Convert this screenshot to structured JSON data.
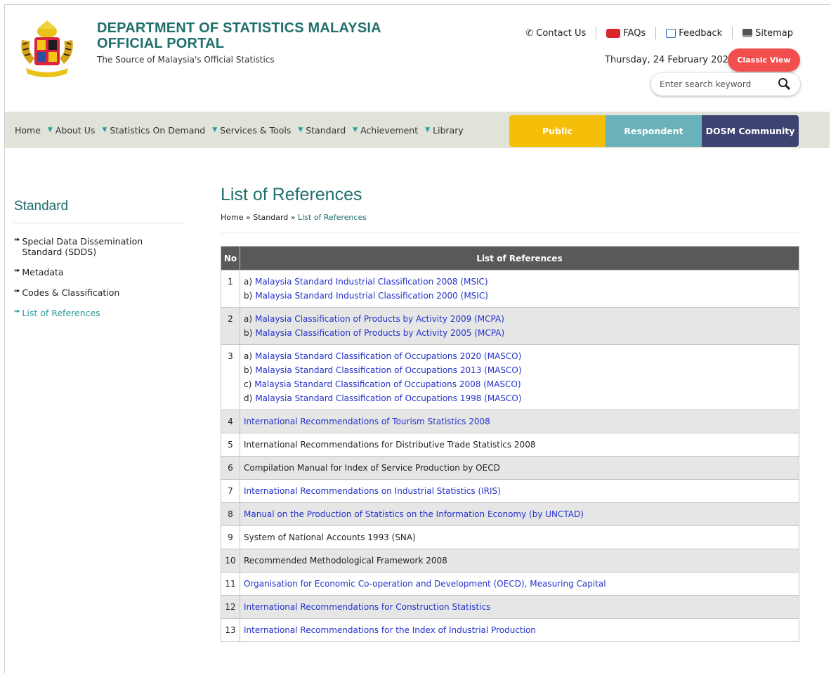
{
  "header": {
    "title_line1": "DEPARTMENT OF STATISTICS MALAYSIA",
    "title_line2": "OFFICIAL PORTAL",
    "subtitle": "The Source of Malaysia's Official Statistics",
    "links": [
      "Contact Us",
      "FAQs",
      "Feedback",
      "Sitemap"
    ],
    "date": "Thursday, 24 February 2022",
    "classic_view": "Classic View",
    "search_placeholder": "Enter search keyword"
  },
  "nav": {
    "home": "Home",
    "items": [
      "About Us",
      "Statistics On Demand",
      "Services & Tools",
      "Standard",
      "Achievement",
      "Library"
    ],
    "audiences": [
      "Public",
      "Respondent",
      "DOSM Community"
    ]
  },
  "sidebar": {
    "title": "Standard",
    "items": [
      "Special Data Dissemination Standard (SDDS)",
      "Metadata",
      "Codes & Classification",
      "List of References"
    ]
  },
  "main": {
    "title": "List of References",
    "breadcrumb": {
      "home": "Home",
      "sep": "»",
      "section": "Standard",
      "current": "List of References"
    },
    "table": {
      "headers": [
        "No",
        "List of References"
      ],
      "rows": [
        {
          "no": "1",
          "items": [
            {
              "label": "a)",
              "text": "Malaysia Standard Industrial Classification 2008 (MSIC)",
              "link": true
            },
            {
              "label": "b)",
              "text": "Malaysia Standard Industrial Classification 2000 (MSIC)",
              "link": true
            }
          ]
        },
        {
          "no": "2",
          "items": [
            {
              "label": "a)",
              "text": "Malaysia Classification of Products by Activity 2009 (MCPA)",
              "link": true
            },
            {
              "label": "b)",
              "text": "Malaysia Classification of Products by Activity 2005 (MCPA)",
              "link": true
            }
          ]
        },
        {
          "no": "3",
          "items": [
            {
              "label": "a)",
              "text": "Malaysia Standard Classification of Occupations 2020 (MASCO)",
              "link": true
            },
            {
              "label": "b)",
              "text": "Malaysia Standard Classification of Occupations 2013 (MASCO)",
              "link": true
            },
            {
              "label": "c)",
              "text": "Malaysia Standard Classification of Occupations 2008 (MASCO)",
              "link": true
            },
            {
              "label": "d)",
              "text": "Malaysia Standard Classification of Occupations 1998 (MASCO)",
              "link": true
            }
          ]
        },
        {
          "no": "4",
          "items": [
            {
              "label": "",
              "text": "International Recommendations of Tourism Statistics 2008",
              "link": true
            }
          ]
        },
        {
          "no": "5",
          "items": [
            {
              "label": "",
              "text": "International Recommendations for Distributive Trade Statistics 2008",
              "link": false
            }
          ]
        },
        {
          "no": "6",
          "items": [
            {
              "label": "",
              "text": "Compilation Manual for Index of Service Production by OECD",
              "link": false
            }
          ]
        },
        {
          "no": "7",
          "items": [
            {
              "label": "",
              "text": "International Recommendations on Industrial Statistics (IRIS)",
              "link": true
            }
          ]
        },
        {
          "no": "8",
          "items": [
            {
              "label": "",
              "text": "Manual on the Production of Statistics on the Information Economy (by UNCTAD)",
              "link": true
            }
          ]
        },
        {
          "no": "9",
          "items": [
            {
              "label": "",
              "text": "System of National Accounts 1993 (SNA)",
              "link": false
            }
          ]
        },
        {
          "no": "10",
          "items": [
            {
              "label": "",
              "text": "Recommended Methodological Framework 2008",
              "link": false
            }
          ]
        },
        {
          "no": "11",
          "items": [
            {
              "label": "",
              "text": "Organisation for Economic Co-operation and Development (OECD), Measuring Capital",
              "link": true
            }
          ]
        },
        {
          "no": "12",
          "items": [
            {
              "label": "",
              "text": "International Recommendations for Construction Statistics",
              "link": true
            }
          ]
        },
        {
          "no": "13",
          "items": [
            {
              "label": "",
              "text": "International Recommendations for the Index of Industrial Production",
              "link": true
            }
          ]
        }
      ]
    }
  },
  "colors": {
    "brand": "#1f6f6b",
    "link": "#2332c9",
    "classic": "#f24e4e",
    "public": "#f5be09",
    "respondent": "#6ab2ba",
    "community": "#3d4472"
  }
}
